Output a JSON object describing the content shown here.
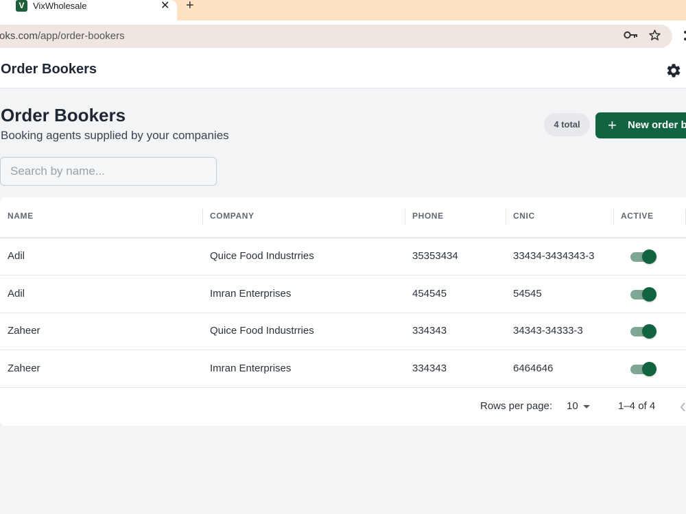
{
  "browser": {
    "tab_title": "VixWholesale",
    "tab_favicon_letter": "V",
    "tab_close": "✕",
    "new_tab": "+",
    "url_host": "oks.com",
    "url_path": "/app/order-bookers"
  },
  "header": {
    "title": "Order Bookers"
  },
  "page": {
    "title": "Order Bookers",
    "subtitle": "Booking agents supplied by your companies",
    "count_badge": "4 total",
    "new_button_plus": "+",
    "new_button_label": "New order b",
    "search_placeholder": "Search by name..."
  },
  "table": {
    "headers": [
      "NAME",
      "COMPANY",
      "PHONE",
      "CNIC",
      "ACTIVE"
    ],
    "rows": [
      {
        "name": "Adil",
        "company": "Quice Food Industrries",
        "phone": "35353434",
        "cnic": "33434-3434343-3",
        "active": true
      },
      {
        "name": "Adil",
        "company": "Imran Enterprises",
        "phone": "454545",
        "cnic": "54545",
        "active": true
      },
      {
        "name": "Zaheer",
        "company": "Quice Food Industrries",
        "phone": "334343",
        "cnic": "34343-34333-3",
        "active": true
      },
      {
        "name": "Zaheer",
        "company": "Imran Enterprises",
        "phone": "334343",
        "cnic": "6464646",
        "active": true
      }
    ]
  },
  "pagination": {
    "rows_per_page_label": "Rows per page:",
    "rows_per_page_value": "10",
    "range": "1–4 of 4"
  },
  "colors": {
    "accent": "#12633f",
    "tabbar": "#fde2c4",
    "switch_track": "#7fa894"
  },
  "icons": {
    "key": "key-icon",
    "star": "star-icon",
    "settings": "gear-icon",
    "prev": "chevron-left-icon",
    "dropdown": "caret-down-icon"
  }
}
